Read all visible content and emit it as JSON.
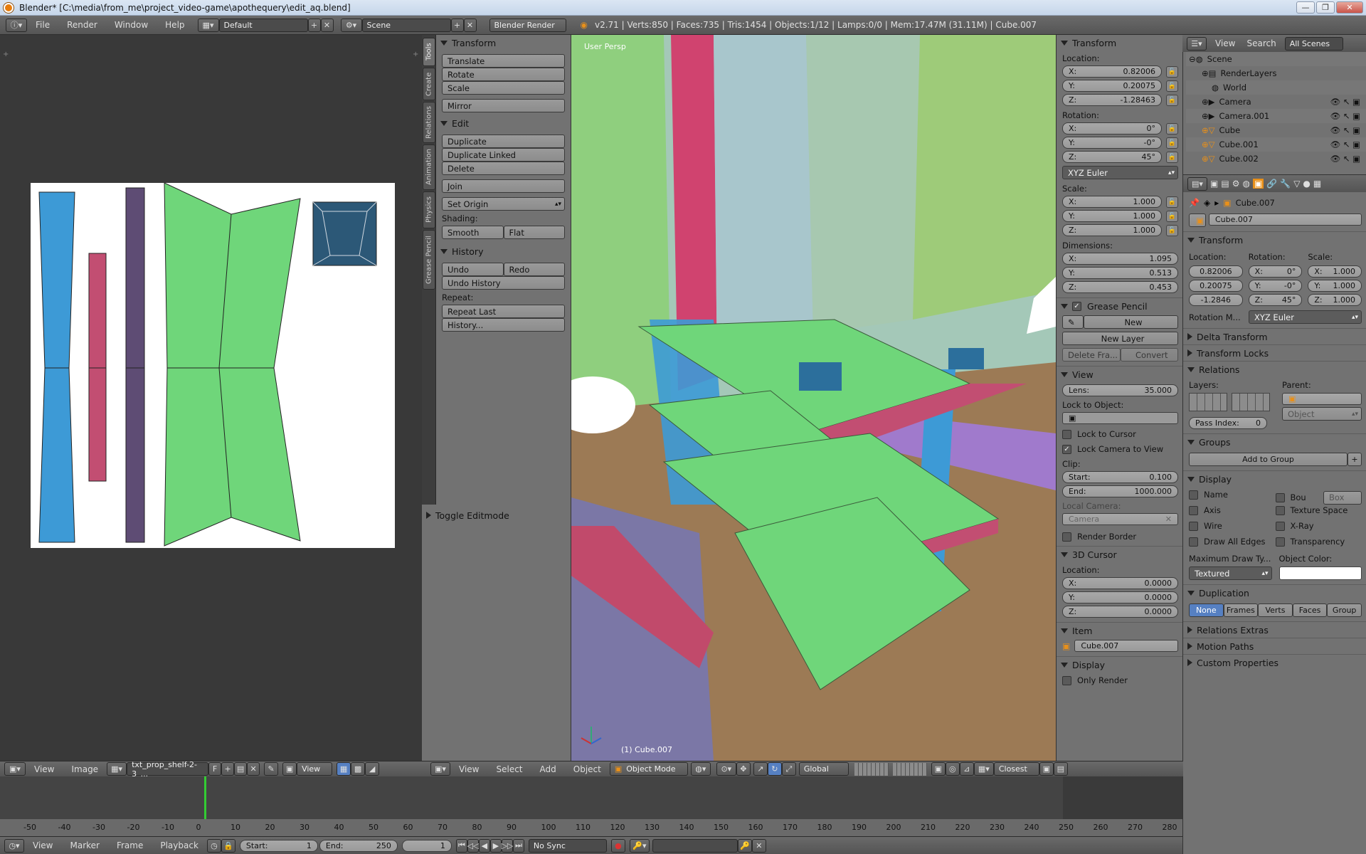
{
  "window": {
    "title": "Blender* [C:\\media\\from_me\\project_video-game\\apothequery\\edit_aq.blend]",
    "min": "—",
    "max": "❐",
    "close": "✕"
  },
  "topbar": {
    "menus": [
      "File",
      "Render",
      "Window",
      "Help"
    ],
    "layout": "Default",
    "scene": "Scene",
    "engine": "Blender Render",
    "stats": "v2.71 | Verts:850 | Faces:735 | Tris:1454 | Objects:1/12 | Lamps:0/0 | Mem:17.47M (31.11M) | Cube.007"
  },
  "tooltabs": [
    "Tools",
    "Create",
    "Relations",
    "Animation",
    "Physics",
    "Grease Pencil"
  ],
  "tools": {
    "transform": {
      "title": "Transform",
      "buttons": [
        "Translate",
        "Rotate",
        "Scale",
        "Mirror"
      ]
    },
    "edit": {
      "title": "Edit",
      "buttons": [
        "Duplicate",
        "Duplicate Linked",
        "Delete",
        "Join"
      ],
      "set_origin": "Set Origin",
      "shading_label": "Shading:",
      "smooth": "Smooth",
      "flat": "Flat"
    },
    "history": {
      "title": "History",
      "undo": "Undo",
      "redo": "Redo",
      "undo_history": "Undo History",
      "repeat_label": "Repeat:",
      "repeat_last": "Repeat Last",
      "history_btn": "History..."
    },
    "toggle_editmode": "Toggle Editmode"
  },
  "viewport": {
    "label": "User Persp",
    "object_label": "(1) Cube.007"
  },
  "npanel": {
    "transform": {
      "title": "Transform",
      "location_label": "Location:",
      "location": [
        [
          "X:",
          "0.82006"
        ],
        [
          "Y:",
          "0.20075"
        ],
        [
          "Z:",
          "-1.28463"
        ]
      ],
      "rotation_label": "Rotation:",
      "rotation": [
        [
          "X:",
          "0°"
        ],
        [
          "Y:",
          "-0°"
        ],
        [
          "Z:",
          "45°"
        ]
      ],
      "rotation_mode": "XYZ Euler",
      "scale_label": "Scale:",
      "scale": [
        [
          "X:",
          "1.000"
        ],
        [
          "Y:",
          "1.000"
        ],
        [
          "Z:",
          "1.000"
        ]
      ],
      "dimensions_label": "Dimensions:",
      "dimensions": [
        [
          "X:",
          "1.095"
        ],
        [
          "Y:",
          "0.513"
        ],
        [
          "Z:",
          "0.453"
        ]
      ]
    },
    "grease": {
      "title": "Grease Pencil",
      "new": "New",
      "new_layer": "New Layer",
      "delete_frame": "Delete Fra...",
      "convert": "Convert"
    },
    "view": {
      "title": "View",
      "lens_k": "Lens:",
      "lens_v": "35.000",
      "lock_object": "Lock to Object:",
      "lock_cursor": "Lock to Cursor",
      "lock_camera": "Lock Camera to View",
      "clip": "Clip:",
      "start_k": "Start:",
      "start_v": "0.100",
      "end_k": "End:",
      "end_v": "1000.000",
      "local_camera": "Local Camera:",
      "camera": "Camera",
      "render_border": "Render Border"
    },
    "cursor": {
      "title": "3D Cursor",
      "location_label": "Location:",
      "location": [
        [
          "X:",
          "0.0000"
        ],
        [
          "Y:",
          "0.0000"
        ],
        [
          "Z:",
          "0.0000"
        ]
      ]
    },
    "item": {
      "title": "Item",
      "name": "Cube.007"
    },
    "display": {
      "title": "Display",
      "only_render": "Only Render"
    }
  },
  "outliner": {
    "view": "View",
    "search": "Search",
    "scope": "All Scenes",
    "items": [
      "Scene",
      "RenderLayers",
      "World",
      "Camera",
      "Camera.001",
      "Cube",
      "Cube.001",
      "Cube.002"
    ]
  },
  "props": {
    "object_path": "Cube.007",
    "object_name": "Cube.007",
    "transform_title": "Transform",
    "loc_label": "Location:",
    "rot_label": "Rotation:",
    "scale_label": "Scale:",
    "loc": [
      "0.82006",
      "0.20075",
      "-1.2846"
    ],
    "rot": [
      [
        "X:",
        "0°"
      ],
      [
        "Y:",
        "-0°"
      ],
      [
        "Z:",
        "45°"
      ]
    ],
    "scale": [
      [
        "X:",
        "1.000"
      ],
      [
        "Y:",
        "1.000"
      ],
      [
        "Z:",
        "1.000"
      ]
    ],
    "rotation_mode_k": "Rotation M...",
    "rotation_mode_v": "XYZ Euler",
    "delta": "Delta Transform",
    "locks": "Transform Locks",
    "relations": "Relations",
    "layers": "Layers:",
    "parent": "Parent:",
    "parent_type": "Object",
    "pass_index": "Pass Index:",
    "pass_value": "0",
    "groups": "Groups",
    "add_group": "Add to Group",
    "display": "Display",
    "disp_left": [
      "Name",
      "Axis",
      "Wire",
      "Draw All Edges"
    ],
    "disp_right": [
      "Bou",
      "Texture Space",
      "X-Ray",
      "Transparency"
    ],
    "bounds_type": "Box",
    "max_draw": "Maximum Draw Ty...",
    "object_color": "Object Color:",
    "draw_type": "Textured",
    "duplication": "Duplication",
    "dup_options": [
      "None",
      "Frames",
      "Verts",
      "Faces",
      "Group"
    ],
    "relations_extras": "Relations Extras",
    "motion_paths": "Motion Paths",
    "custom_props": "Custom Properties"
  },
  "image_header": {
    "view": "View",
    "image": "Image",
    "image_name": "txt_prop_shelf-2-3_...",
    "f": "F",
    "view2": "View"
  },
  "vp_header": {
    "view": "View",
    "select": "Select",
    "add": "Add",
    "object": "Object",
    "mode": "Object Mode",
    "orientation": "Global",
    "snap": "Closest"
  },
  "timeline": {
    "ticks": [
      "-50",
      "-40",
      "-30",
      "-20",
      "-10",
      "0",
      "10",
      "20",
      "30",
      "40",
      "50",
      "60",
      "70",
      "80",
      "90",
      "100",
      "110",
      "120",
      "130",
      "140",
      "150",
      "160",
      "170",
      "180",
      "190",
      "200",
      "210",
      "220",
      "230",
      "240",
      "250",
      "260",
      "270",
      "280"
    ],
    "current_frame": 0
  },
  "tl_header": {
    "view": "View",
    "marker": "Marker",
    "frame": "Frame",
    "playback": "Playback",
    "start_k": "Start:",
    "start_v": "1",
    "end_k": "End:",
    "end_v": "250",
    "current": "1",
    "sync": "No Sync"
  },
  "colors": {
    "uv_blue": "#3d9ad6",
    "uv_pink": "#c24e72",
    "uv_purple": "#5e4c74",
    "uv_green": "#6fd67a",
    "uv_dark": "#2c5877"
  }
}
